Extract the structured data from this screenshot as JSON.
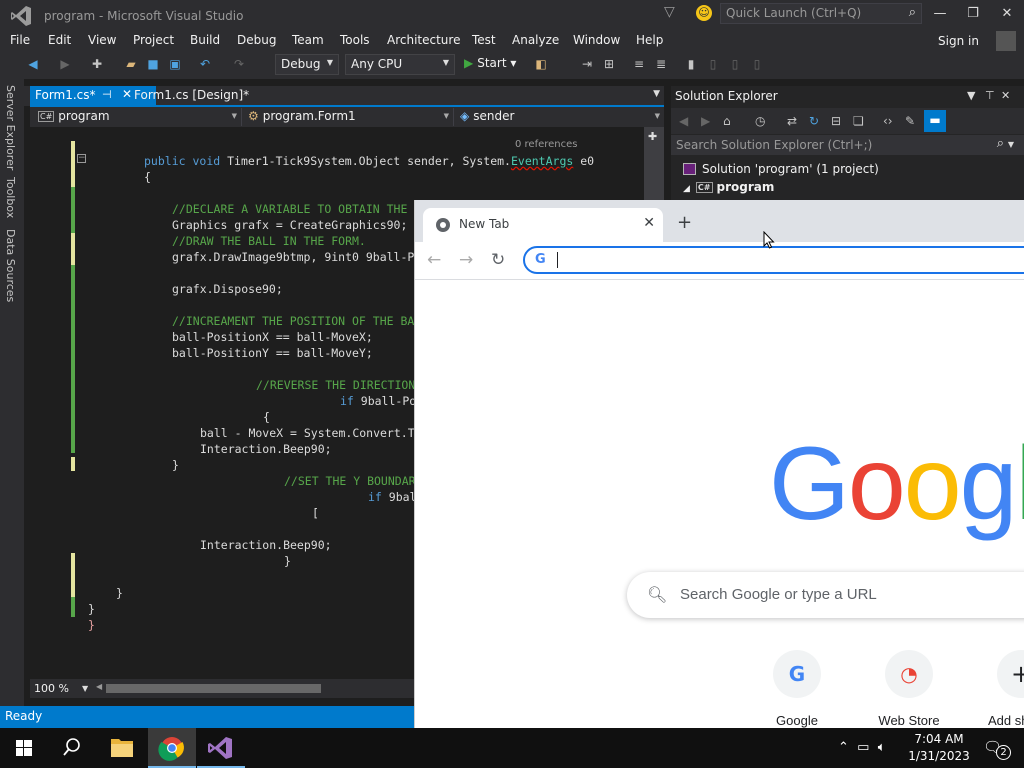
{
  "vs": {
    "title": "program - Microsoft Visual Studio",
    "quick_launch": "Quick Launch (Ctrl+Q)",
    "menu": [
      "File",
      "Edit",
      "View",
      "Project",
      "Build",
      "Debug",
      "Team",
      "Tools",
      "Architecture",
      "Test",
      "Analyze",
      "Window",
      "Help"
    ],
    "sign_in": "Sign in",
    "toolbar": {
      "config": "Debug",
      "platform": "Any CPU",
      "start": "Start"
    },
    "left_tabs": [
      "Server Explorer",
      "Toolbox",
      "Data Sources"
    ],
    "doc_tabs": [
      "Form1.cs*",
      "Form1.cs [Design]*"
    ],
    "nav": {
      "project": "program",
      "class": "program.Form1",
      "member": "sender",
      "project_badge": "C#"
    },
    "code_lens": "0 references",
    "code": {
      "l0_kw1": "public",
      "l0_kw2": "void",
      "l0_a": " Timer1-Tick9System.Object sender, System.",
      "l0_type": "EventArgs",
      "l0_b": " e0",
      "l1": "{",
      "l2": "//DECLARE A VARIABLE TO OBTAIN THE",
      "l3": "Graphics grafx = CreateGraphics90;",
      "l4": "//DRAW THE BALL IN THE FORM.",
      "l5": "grafx.DrawImage9btmp, 9int0 9ball-P",
      "l6": "grafx.Dispose90;",
      "l7": "//INCREAMENT THE POSITION OF THE BA",
      "l8": "ball-PositionX == ball-MoveX;",
      "l9": "ball-PositionY == ball-MoveY;",
      "l10": "//REVERSE THE DIRECTION",
      "l11_kw": "if",
      "l11": " 9ball-Po",
      "l12": "{",
      "l13": "ball - MoveX = System.Convert.T",
      "l14": "Interaction.Beep90;",
      "l15": "}",
      "l16": "//SET THE Y BOUNDAR",
      "l17_kw": "if",
      "l17": " 9bal",
      "l18": "[",
      "l19": "Interaction.Beep90;",
      "l20": "}",
      "l21": "}",
      "l22": "}",
      "l23": "}"
    },
    "zoom": "100 %",
    "status": "Ready",
    "solution_explorer": {
      "title": "Solution Explorer",
      "search": "Search Solution Explorer (Ctrl+;)",
      "solution": "Solution 'program' (1 project)",
      "project": "program"
    }
  },
  "chrome": {
    "tab_title": "New Tab",
    "logo": "Google",
    "search_placeholder": "Search Google or type a URL",
    "tiles": [
      {
        "label": "Google",
        "glyph": "G"
      },
      {
        "label": "Web Store",
        "glyph": "◔"
      },
      {
        "label": "Add sho",
        "glyph": "+"
      }
    ]
  },
  "taskbar": {
    "time": "7:04 AM",
    "date": "1/31/2023",
    "notifications": "2"
  },
  "colors": {
    "vs_accent": "#007acc",
    "google_blue": "#4285f4",
    "google_red": "#ea4335",
    "google_yellow": "#fbbc05",
    "google_green": "#34a853"
  }
}
